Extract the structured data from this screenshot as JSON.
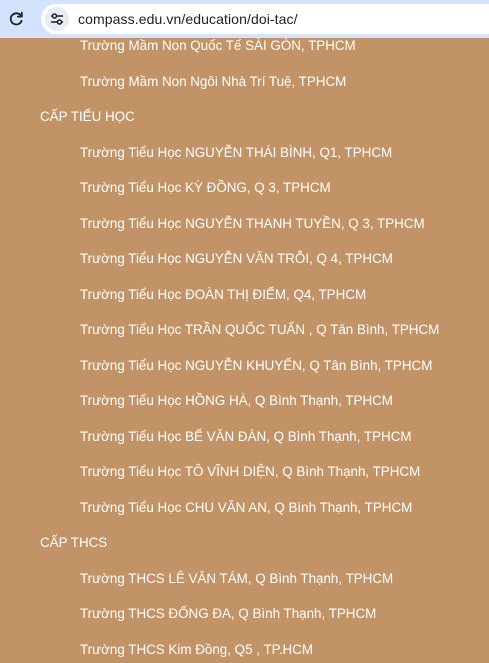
{
  "browser": {
    "url": "compass.edu.vn/education/doi-tac/"
  },
  "page": {
    "rows": [
      {
        "kind": "item",
        "text": "Trường Mầm Non Quốc Tế SÀI GÒN, TPHCM"
      },
      {
        "kind": "item",
        "text": "Trường Mầm Non Ngôi Nhà Trí Tuệ, TPHCM"
      },
      {
        "kind": "heading",
        "text": "CẤP TIỂU HỌC"
      },
      {
        "kind": "item",
        "text": "Trường Tiểu Học NGUYỄN THÁI BÌNH, Q1, TPHCM"
      },
      {
        "kind": "item",
        "text": "Trường Tiểu Học KỲ ĐỒNG, Q 3, TPHCM"
      },
      {
        "kind": "item",
        "text": "Trường Tiểu Học NGUYỄN THANH TUYỀN, Q 3, TPHCM"
      },
      {
        "kind": "item",
        "text": "Trường Tiểu Học NGUYỄN VĂN TRỖI, Q 4, TPHCM"
      },
      {
        "kind": "item",
        "text": "Trường Tiểu Học ĐOÀN THỊ ĐIỂM, Q4, TPHCM"
      },
      {
        "kind": "item",
        "text": "Trường Tiểu Học TRẦN QUỐC TUẤN , Q Tân Bình, TPHCM"
      },
      {
        "kind": "item",
        "text": "Trường Tiểu Học NGUYỄN KHUYẾN, Q Tân Bình, TPHCM"
      },
      {
        "kind": "item",
        "text": "Trường Tiểu Học HỒNG HÀ, Q Bình Thạnh, TPHCM"
      },
      {
        "kind": "item",
        "text": "Trường Tiểu Học BẾ VĂN ĐÀN, Q Bình Thạnh, TPHCM"
      },
      {
        "kind": "item",
        "text": "Trường Tiểu Học TÔ VĨNH DIỆN, Q Bình Thạnh, TPHCM"
      },
      {
        "kind": "item",
        "text": "Trường Tiểu Học CHU VĂN AN, Q Bình Thạnh, TPHCM"
      },
      {
        "kind": "heading",
        "text": "CẤP THCS"
      },
      {
        "kind": "item",
        "text": "Trường THCS LÊ VĂN TÁM, Q Bình Thạnh, TPHCM"
      },
      {
        "kind": "item",
        "text": "Trường THCS ĐỐNG ĐA, Q Bình Thạnh, TPHCM"
      },
      {
        "kind": "item",
        "text": "Trường THCS Kim Đồng, Q5 , TP.HCM"
      }
    ]
  },
  "colors": {
    "page_background": "#c29367",
    "text": "#ffffff",
    "browser_bar": "#d3e3fd"
  },
  "icons": {
    "reload": "reload-icon",
    "site_info": "site-info-icon"
  }
}
